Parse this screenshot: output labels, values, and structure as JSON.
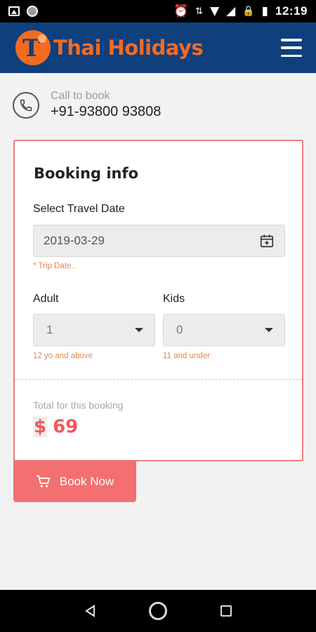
{
  "status_bar": {
    "time": "12:19",
    "left_icons": [
      "gallery-icon",
      "circle-icon"
    ],
    "right_icons": [
      "alarm-icon",
      "data-arrows-icon",
      "wifi-icon",
      "signal-icon",
      "lock-icon",
      "battery-icon"
    ]
  },
  "header": {
    "brand": "Thai Holidays",
    "logo_letter": "T",
    "brand_color": "#f26b21",
    "background_color": "#0f3f7d"
  },
  "contact": {
    "label": "Call to book",
    "phone": "+91-93800 93808"
  },
  "booking": {
    "title": "Booking info",
    "date_label": "Select Travel Date",
    "date_value": "2019-03-29",
    "date_hint": "* Trip Date..",
    "adult_label": "Adult",
    "adult_value": "1",
    "adult_hint": "12 yo and above",
    "kids_label": "Kids",
    "kids_value": "0",
    "kids_hint": "11 and under",
    "total_label": "Total for this booking",
    "currency": "$",
    "total_amount": "69",
    "accent_color": "#ef5a5a"
  },
  "actions": {
    "book_now": "Book Now"
  }
}
